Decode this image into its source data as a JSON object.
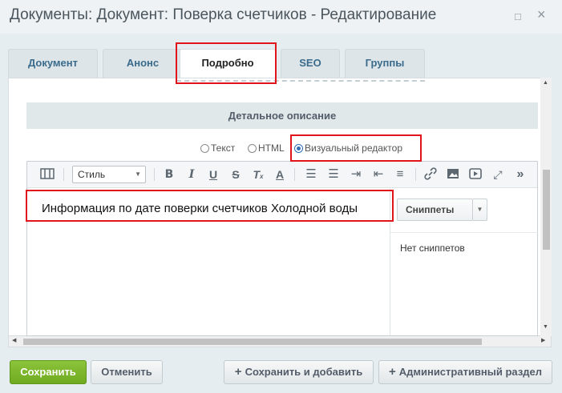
{
  "window": {
    "title": "Документы: Документ: Поверка счетчиков - Редактирование",
    "maximize_glyph": "□",
    "close_glyph": "×"
  },
  "tabs": [
    {
      "label": "Документ",
      "active": false
    },
    {
      "label": "Анонс",
      "active": false
    },
    {
      "label": "Подробно",
      "active": true
    },
    {
      "label": "SEO",
      "active": false
    },
    {
      "label": "Группы",
      "active": false
    }
  ],
  "section": {
    "title": "Детальное описание"
  },
  "modes": {
    "text": "Текст",
    "html": "HTML",
    "visual": "Визуальный редактор",
    "selected": "visual"
  },
  "toolbar": {
    "style_value": "Стиль",
    "icons": [
      "fullscreen-toggle-icon",
      "bold-icon",
      "italic-icon",
      "underline-icon",
      "strikethrough-icon",
      "remove-format-icon",
      "text-color-icon",
      "ordered-list-icon",
      "unordered-list-icon",
      "indent-icon",
      "outdent-icon",
      "align-icon",
      "link-icon",
      "image-icon",
      "video-icon",
      "expand-icon",
      "more-icon"
    ]
  },
  "editor": {
    "content": "Информация по дате поверки счетчиков Холодной воды"
  },
  "snippets": {
    "button_label": "Сниппеты",
    "empty_text": "Нет сниппетов"
  },
  "footer": {
    "save": "Сохранить",
    "cancel": "Отменить",
    "save_and_add": "Сохранить и добавить",
    "admin_section": "Административный раздел"
  },
  "colors": {
    "highlight": "#e0141a",
    "save_button": "#7ab52c",
    "tab_text": "#3a6b8c"
  }
}
